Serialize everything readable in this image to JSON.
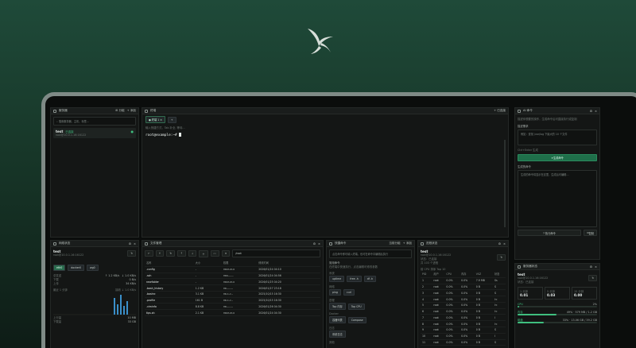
{
  "servers": {
    "title": "服务器",
    "group_label": "分组",
    "add_label": "添加",
    "search_placeholder": "搜索服务器、主机、标签…",
    "items": [
      {
        "name": "test",
        "tag": "已连接",
        "address": "root@10.0.1.16:16122"
      }
    ]
  },
  "terminal": {
    "title": "终端",
    "new_label": "已连接",
    "tab": "终端 1",
    "hint": "输入快捷方式，Tab 补全, 等待…",
    "prompt": "root@example:~#"
  },
  "ai": {
    "title": "AI 命令",
    "desc": "描述你想要的操作，生成命令后可直接执行或复制",
    "input_label": "描述需求",
    "input_placeholder": "例如：查找 /var/log 下最大的 10 个文件",
    "mode": "Ctrl+Enter 生成",
    "generate_label": "生成命令",
    "output_label": "生成的命令",
    "output_placeholder": "生成的命令将显示在这里，生成后可编辑…",
    "exec_label": "执行命令",
    "copy_label": "复制"
  },
  "netstat": {
    "title": "网络状态",
    "host": "test",
    "address": "root@10.0.1.16:16122",
    "tabs": [
      "eth0",
      "docker0",
      "wg0"
    ],
    "upload_label": "总发送",
    "upload": "↑ 1.2 KB/s",
    "download": "↓ 1.0 KB/s",
    "rx_label": "下载",
    "rx": "0 B/s",
    "tx_label": "上传",
    "tx": "34 KB/s",
    "chart_label": "最近 1 分钟",
    "legend": "接收 ↓ 1.0 KB/s",
    "footer_a": "上行量",
    "footer_b": "下载量",
    "footer_a_val": "10 MB",
    "footer_b_val": "33 GB"
  },
  "files": {
    "title": "文件管理",
    "path": "/root",
    "columns": [
      "名称",
      "大小",
      "权限",
      "修改时间"
    ],
    "rows": [
      [
        ".config",
        "-",
        "rwxr-xr-x",
        "2026/01/24 04:10"
      ],
      [
        ".ssh",
        "-",
        "rwx------",
        "2026/01/24 04:56"
      ],
      [
        "newfolder",
        "-",
        "rwxr-xr-x",
        "2026/01/25 04:20"
      ],
      [
        ".bash_history",
        "1.2 KB",
        "rw-------",
        "2026/01/27 23:18"
      ],
      [
        ".bashrc",
        "3.1 KB",
        "rw-r--r--",
        "2025/10/15 16:30"
      ],
      [
        ".profile",
        "161 B",
        "rw-r--r--",
        "2025/10/15 16:30"
      ],
      [
        ".viminfo",
        "8.8 KB",
        "rw-------",
        "2026/01/26 04:30"
      ],
      [
        "tips.sh",
        "2.1 KB",
        "rwxr-xr-x",
        "2026/01/24 04:30"
      ]
    ]
  },
  "quick": {
    "title": "快捷命令",
    "scope": "当前分组",
    "add_label": "添加",
    "hint": "点击命令即可填入终端，也可在命令中编辑后执行",
    "group1": "常用命令",
    "group1_desc": "在终端中快速执行，点击编辑可修改参数",
    "sys_label": "系统",
    "sys_cmds": [
      "uptime",
      "free -h",
      "df -h"
    ],
    "net_label": "网络",
    "net_cmds": [
      "ping",
      "curl"
    ],
    "proc_label": "进程",
    "proc_cmds": [
      "Top 内存",
      "Top CPU"
    ],
    "docker_label": "Docker",
    "docker_cmds": [
      "容器列表",
      "Compose"
    ],
    "other_label": "日志",
    "other_cmds": [
      "系统日志"
    ],
    "last_label": "其他"
  },
  "proc": {
    "title": "进程状态",
    "host": "test",
    "address": "root@10.0.1.16:16122",
    "status": "状态：已连接",
    "count": "共 103 个进程",
    "sub": "前 CPU 排序 Top 10",
    "columns": [
      "PID",
      "用户",
      "CPU",
      "内存",
      "VSZ",
      "状态"
    ],
    "rows": [
      [
        "1",
        "root",
        "0.0%",
        "0.0%",
        "7.9 MB",
        "Ss"
      ],
      [
        "2",
        "root",
        "0.0%",
        "0.0%",
        "0 B",
        "S"
      ],
      [
        "3",
        "root",
        "0.0%",
        "0.0%",
        "0 B",
        "S"
      ],
      [
        "4",
        "root",
        "0.0%",
        "0.0%",
        "0 B",
        "I<"
      ],
      [
        "5",
        "root",
        "0.0%",
        "0.0%",
        "0 B",
        "I<"
      ],
      [
        "6",
        "root",
        "0.0%",
        "0.0%",
        "0 B",
        "I<"
      ],
      [
        "7",
        "root",
        "0.0%",
        "0.0%",
        "0 B",
        "I"
      ],
      [
        "8",
        "root",
        "0.0%",
        "0.0%",
        "0 B",
        "I<"
      ],
      [
        "9",
        "root",
        "0.0%",
        "0.0%",
        "0 B",
        "S"
      ],
      [
        "10",
        "root",
        "0.0%",
        "0.0%",
        "0 B",
        "I"
      ],
      [
        "11",
        "root",
        "0.0%",
        "0.0%",
        "0 B",
        "S"
      ]
    ]
  },
  "sysmon": {
    "title": "服务器状态",
    "host": "test",
    "address": "root@10.0.1.16:16122",
    "status": "状态：已连接",
    "load": [
      {
        "label": "1 分钟",
        "value": "0.01"
      },
      {
        "label": "5 分钟",
        "value": "0.03"
      },
      {
        "label": "15 分钟",
        "value": "0.00"
      }
    ],
    "cpu_label": "CPU",
    "cpu_value": "2%",
    "cpu_pct": 0.02,
    "mem_label": "内存",
    "mem_value": "49% · 579 MB / 1.2 GB",
    "mem_pct": 0.49,
    "disk_label": "磁盘",
    "disk_value": "33% · 13.06 GB / 39.2 GB",
    "disk_pct": 0.33
  }
}
